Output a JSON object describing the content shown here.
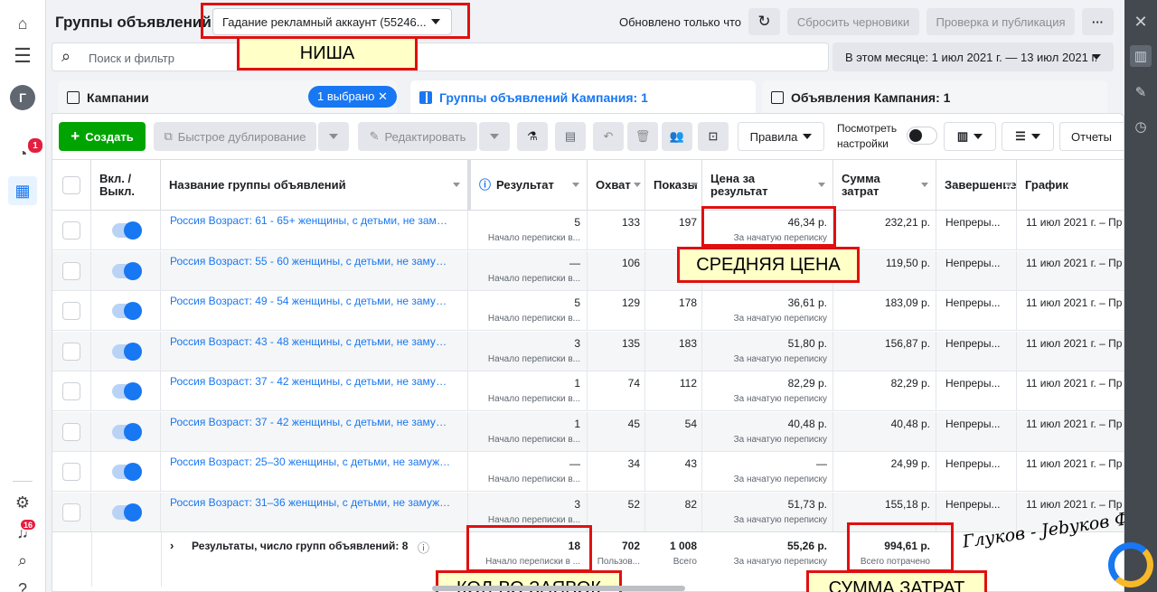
{
  "header": {
    "title": "Группы объявлений",
    "account": "Гадание рекламный аккаунт (55246...",
    "updated": "Обновлено только что",
    "discard": "Сбросить черновики",
    "review": "Проверка и публикация",
    "more": "···"
  },
  "search": {
    "placeholder": "Поиск и фильтр"
  },
  "date_range": "В этом месяце: 1 июл 2021 г. — 13 июл 2021 г.",
  "tabs": {
    "campaigns": "Кампании",
    "selected": "1 выбрано",
    "adsets": "Группы объявлений Кампания: 1",
    "ads": "Объявления Кампания: 1"
  },
  "toolbar": {
    "create": "Создать",
    "duplicate": "Быстрое дублирование",
    "edit": "Редактировать",
    "rules": "Правила",
    "view_settings_1": "Посмотреть",
    "view_settings_2": "настройки",
    "reports": "Отчеты"
  },
  "columns": {
    "toggle_1": "Вкл. /",
    "toggle_2": "Выкл.",
    "name": "Название группы объявлений",
    "result": "Результат",
    "reach": "Охват",
    "impressions": "Показы",
    "cpr_1": "Цена за",
    "cpr_2": "результат",
    "spend_1": "Сумма",
    "spend_2": "затрат",
    "ends": "Завершение",
    "schedule": "График"
  },
  "rows": [
    {
      "name": "Россия Возраст: 61 - 65+ женщины, с детьми, не замужем...",
      "result": "5",
      "result_sub": "Начало переписки в...",
      "reach": "133",
      "impressions": "197",
      "cpr": "46,34 р.",
      "cpr_sub": "За начатую переписку",
      "spend": "232,21 р.",
      "end": "Непреры...",
      "schedule": "11 июл 2021 г. – Пр"
    },
    {
      "name": "Россия Возраст: 55 - 60 женщины, с детьми, не замужем...",
      "result": "—",
      "result_sub": "Начало переписки в...",
      "reach": "106",
      "impressions": "1",
      "cpr": "",
      "cpr_sub": "",
      "spend": "119,50 р.",
      "end": "Непреры...",
      "schedule": "11 июл 2021 г. – Пр"
    },
    {
      "name": "Россия Возраст: 49 - 54 женщины, с детьми, не замужем...",
      "result": "5",
      "result_sub": "Начало переписки в...",
      "reach": "129",
      "impressions": "178",
      "cpr": "36,61 р.",
      "cpr_sub": "За начатую переписку",
      "spend": "183,09 р.",
      "end": "Непреры...",
      "schedule": "11 июл 2021 г. – Пр"
    },
    {
      "name": "Россия Возраст: 43 - 48 женщины, с детьми, не замужем...",
      "result": "3",
      "result_sub": "Начало переписки в...",
      "reach": "135",
      "impressions": "183",
      "cpr": "51,80 р.",
      "cpr_sub": "За начатую переписку",
      "spend": "156,87 р.",
      "end": "Непреры...",
      "schedule": "11 июл 2021 г. – Пр"
    },
    {
      "name": "Россия Возраст: 37 - 42 женщины, с детьми, не замужем...",
      "result": "1",
      "result_sub": "Начало переписки в...",
      "reach": "74",
      "impressions": "112",
      "cpr": "82,29 р.",
      "cpr_sub": "За начатую переписку",
      "spend": "82,29 р.",
      "end": "Непреры...",
      "schedule": "11 июл 2021 г. – Пр"
    },
    {
      "name": "Россия Возраст: 37 - 42 женщины, с детьми, не замужем...",
      "result": "1",
      "result_sub": "Начало переписки в...",
      "reach": "45",
      "impressions": "54",
      "cpr": "40,48 р.",
      "cpr_sub": "За начатую переписку",
      "spend": "40,48 р.",
      "end": "Непреры...",
      "schedule": "11 июл 2021 г. – Пр"
    },
    {
      "name": "Россия Возраст: 25–30 женщины, с детьми, не замужем...",
      "result": "—",
      "result_sub": "Начало переписки в...",
      "reach": "34",
      "impressions": "43",
      "cpr": "—",
      "cpr_sub": "За начатую переписку",
      "spend": "24,99 р.",
      "end": "Непреры...",
      "schedule": "11 июл 2021 г. – Пр"
    },
    {
      "name": "Россия Возраст: 31–36 женщины, с детьми, не замужем...",
      "result": "3",
      "result_sub": "Начало переписки в...",
      "reach": "52",
      "impressions": "82",
      "cpr": "51,73 р.",
      "cpr_sub": "За начатую переписку",
      "spend": "155,18 р.",
      "end": "Непреры...",
      "schedule": "11 июл 2021 г. – Пр"
    }
  ],
  "totals": {
    "label": "Результаты, число групп объявлений: 8",
    "result": "18",
    "result_sub": "Начало переписки в ...",
    "reach": "702",
    "reach_sub": "Пользов...",
    "impressions": "1 008",
    "impressions_sub": "Всего",
    "cpr": "55,26 р.",
    "cpr_sub": "За начатую переписку",
    "spend": "994,61 р.",
    "spend_sub": "Всего потрачено"
  },
  "annotations": {
    "niche": "НИША",
    "avg_price": "СРЕДНЯЯ ЦЕНА",
    "leads": "КОЛ-ВО ЗАЯВОК",
    "spend": "СУММА ЗАТРАТ",
    "signature": "Глуков - Jebyков Ф.Ф."
  },
  "badges": {
    "reports": "1",
    "alerts": "16"
  },
  "avatar": "Г",
  "colors": {
    "accent": "#1877f2",
    "create": "#00a400",
    "annotation": "#e01010"
  }
}
